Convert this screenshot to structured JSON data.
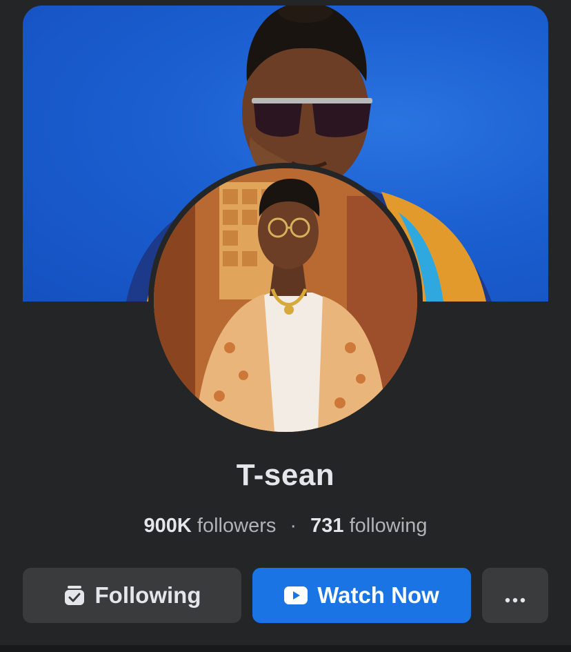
{
  "profile": {
    "name": "T-sean",
    "followers_count": "900K",
    "followers_label": "followers",
    "separator": "·",
    "following_count": "731",
    "following_label": "following"
  },
  "actions": {
    "following_label": "Following",
    "watch_label": "Watch Now",
    "more_label": "···"
  },
  "icons": {
    "following": "following-check-icon",
    "watch": "play-video-icon",
    "more": "more-options-icon"
  },
  "colors": {
    "background": "#242526",
    "primary_button": "#1b74e4",
    "secondary_button": "#3a3b3c",
    "text_primary": "#e4e6eb",
    "text_secondary": "#b0b3b8"
  }
}
